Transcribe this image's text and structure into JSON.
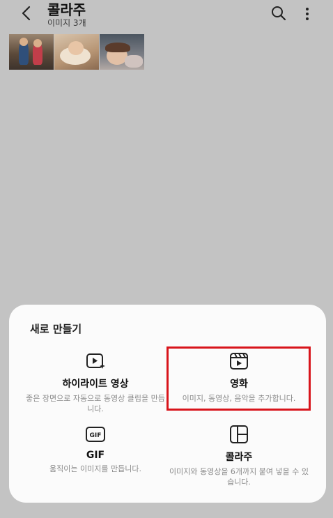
{
  "header": {
    "title": "콜라주",
    "subtitle": "이미지 3개",
    "back_icon": "chevron-left-icon",
    "search_icon": "search-icon",
    "more_icon": "more-vertical-icon"
  },
  "thumbnails": [
    {
      "icon": "photo-two-children"
    },
    {
      "icon": "photo-sleeping-baby"
    },
    {
      "icon": "photo-child-lying"
    }
  ],
  "sheet": {
    "title": "새로 만들기",
    "options": [
      {
        "label": "하이라이트 영상",
        "desc": "좋은 장면으로 자동으로 동영상 클립을 만듭니다.",
        "icon": "highlight-video-icon"
      },
      {
        "label": "영화",
        "desc": "이미지, 동영상, 음악을 추가합니다.",
        "icon": "movie-clapper-icon"
      },
      {
        "label": "GIF",
        "desc": "움직이는 이미지를 만듭니다.",
        "icon": "gif-icon",
        "icon_text": "GIF"
      },
      {
        "label": "콜라주",
        "desc": "이미지와 동영상을 6개까지 붙여 넣을 수 있습니다.",
        "icon": "collage-icon"
      }
    ]
  },
  "colors": {
    "background": "#c3c3c3",
    "sheet": "#fbfbfb",
    "highlight": "#d8141b"
  }
}
